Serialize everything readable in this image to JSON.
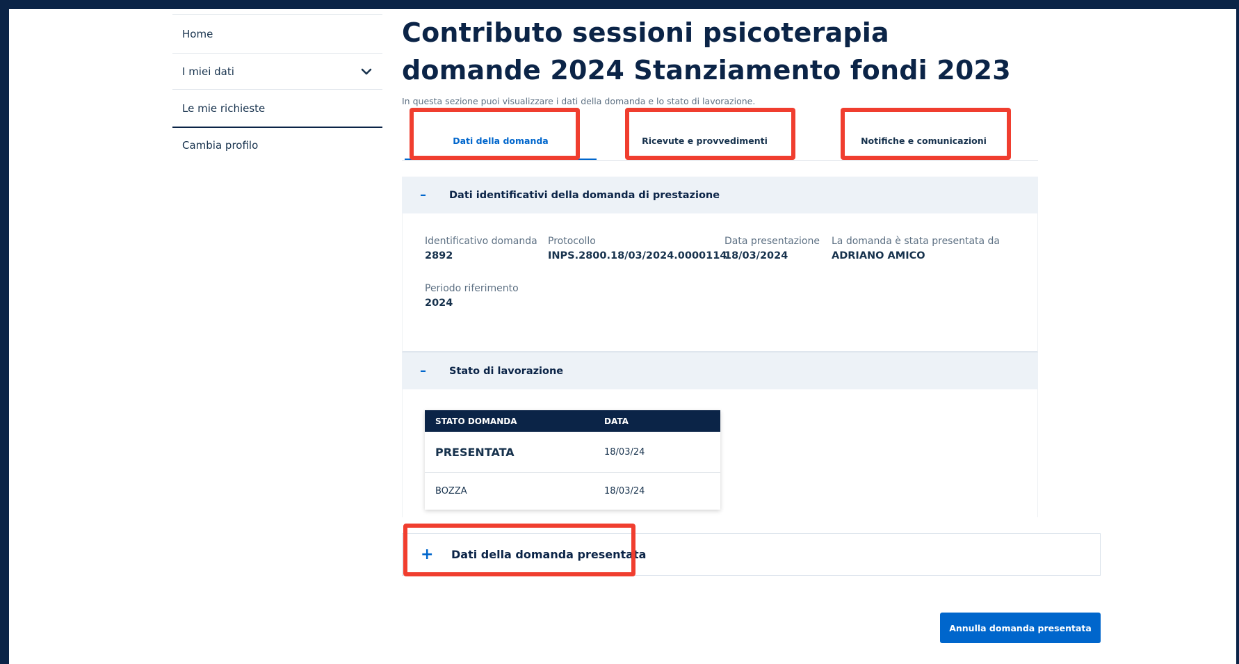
{
  "sidebar": {
    "items": [
      {
        "label": "Home"
      },
      {
        "label": "I miei dati",
        "icon": "chevron-down-icon"
      },
      {
        "label": "Le mie richieste"
      },
      {
        "label": "Cambia profilo"
      }
    ]
  },
  "page": {
    "title": "Contributo sessioni psicoterapia domande 2024 Stanziamento fondi 2023",
    "intro": "In questa sezione puoi visualizzare i dati della domanda e lo stato di lavorazione."
  },
  "tabs": [
    {
      "label": "Dati della domanda",
      "active": true
    },
    {
      "label": "Ricevute e provvedimenti"
    },
    {
      "label": "Notifiche e comunicazioni"
    }
  ],
  "identificativi": {
    "heading": "Dati identificativi della domanda di prestazione",
    "toggle": "–",
    "fields": [
      {
        "label": "Identificativo domanda",
        "value": "2892"
      },
      {
        "label": "Protocollo",
        "value": "INPS.2800.18/03/2024.0000114"
      },
      {
        "label": "Data presentazione",
        "value": "18/03/2024"
      },
      {
        "label": "La domanda è stata presentata da",
        "value": "ADRIANO AMICO"
      },
      {
        "label": "Periodo riferimento",
        "value": "2024"
      }
    ]
  },
  "stato": {
    "heading": "Stato di lavorazione",
    "toggle": "–",
    "columns": [
      "STATO DOMANDA",
      "DATA"
    ],
    "rows": [
      {
        "stato": "PRESENTATA",
        "data": "18/03/24"
      },
      {
        "stato": "BOZZA",
        "data": "18/03/24"
      }
    ]
  },
  "presentata": {
    "heading": "Dati della domanda presentata",
    "toggle": "+"
  },
  "actions": {
    "cancel_label": "Annulla domanda presentata"
  },
  "colors": {
    "primary": "#0066cc",
    "navy": "#0b2447",
    "highlight": "#f03e2f"
  }
}
